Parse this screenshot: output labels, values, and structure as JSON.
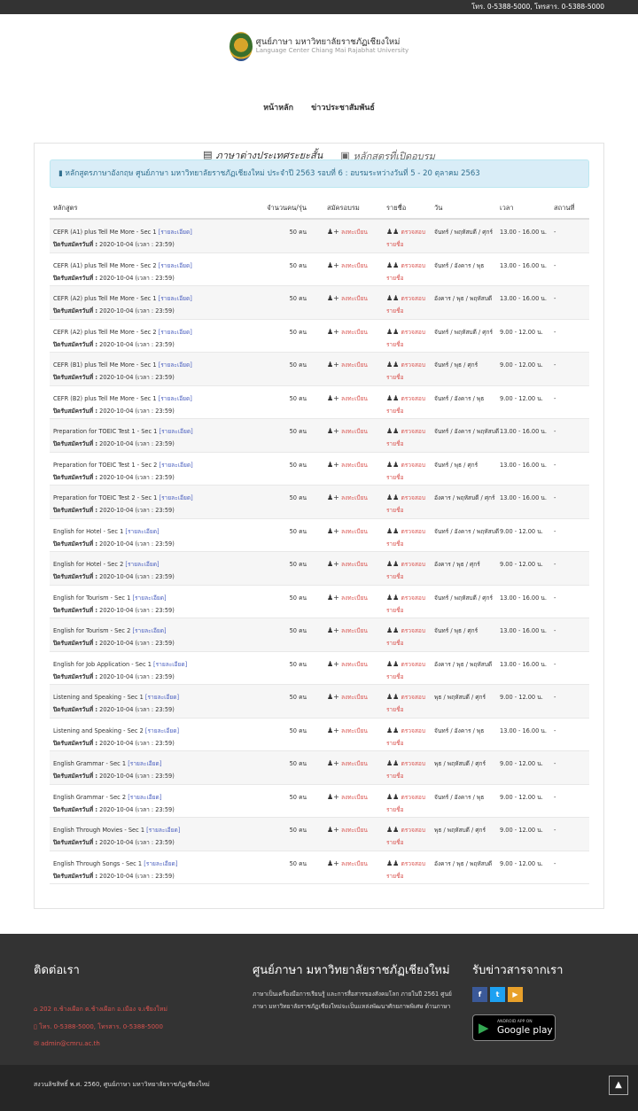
{
  "topbar": {
    "contact": "โทร. 0-5388-5000, โทรสาร. 0-5388-5000"
  },
  "brand": {
    "name_th": "ศูนย์ภาษา มหาวิทยาลัยราชภัฏเชียงใหม่",
    "name_en": "Language Center Chiang Mai Rajabhat University"
  },
  "nav": {
    "home": "หน้าหลัก",
    "news": "ข่าวประชาสัมพันธ์"
  },
  "tabs": {
    "active": "ภาษาต่างประเทศระยะสั้น",
    "inactive": "หลักสูตรที่เปิดอบรม"
  },
  "alert": {
    "text": "หลักสูตรภาษาอังกฤษ ศูนย์ภาษา มหาวิทยาลัยราชภัฏเชียงใหม่ ประจำปี 2563 รอบที่ 6 : อบรมระหว่างวันที่ 5 - 20 ตุลาคม 2563"
  },
  "table": {
    "headers": [
      "หลักสูตร",
      "จำนวนคน/รุ่น",
      "สมัครอบรม",
      "รายชื่อ",
      "วัน",
      "เวลา",
      "สถานที่"
    ],
    "detail_label": "[รายละเอียด]",
    "close_label": "ปิดรับสมัครวันที่ :",
    "register_label": "ลงทะเบียน",
    "check_label": "ตรวจสอบ",
    "check_label2": "รายชื่อ",
    "rows": [
      {
        "course": "CEFR (A1) plus Tell Me More - Sec 1",
        "close": "2020-10-04 (เวลา : 23:59)",
        "count": "50 คน",
        "days": "จันทร์ / พฤหัสบดี / ศุกร์",
        "time": "13.00 - 16.00 น.",
        "place": "-"
      },
      {
        "course": "CEFR (A1) plus Tell Me More - Sec 2",
        "close": "2020-10-04 (เวลา : 23:59)",
        "count": "50 คน",
        "days": "จันทร์ / อังคาร / พุธ",
        "time": "13.00 - 16.00 น.",
        "place": "-"
      },
      {
        "course": "CEFR (A2) plus Tell Me More - Sec 1",
        "close": "2020-10-04 (เวลา : 23:59)",
        "count": "50 คน",
        "days": "อังคาร / พุธ / พฤหัสบดี",
        "time": "13.00 - 16.00 น.",
        "place": "-"
      },
      {
        "course": "CEFR (A2) plus Tell Me More - Sec 2",
        "close": "2020-10-04 (เวลา : 23:59)",
        "count": "50 คน",
        "days": "จันทร์ / พฤหัสบดี / ศุกร์",
        "time": "9.00 - 12.00 น.",
        "place": "-"
      },
      {
        "course": "CEFR (B1) plus Tell Me More - Sec 1",
        "close": "2020-10-04 (เวลา : 23:59)",
        "count": "50 คน",
        "days": "จันทร์ / พุธ / ศุกร์",
        "time": "9.00 - 12.00 น.",
        "place": "-"
      },
      {
        "course": "CEFR (B2) plus Tell Me More - Sec 1",
        "close": "2020-10-04 (เวลา : 23:59)",
        "count": "50 คน",
        "days": "จันทร์ / อังคาร / พุธ",
        "time": "9.00 - 12.00 น.",
        "place": "-"
      },
      {
        "course": "Preparation for TOEIC Test 1 - Sec 1",
        "close": "2020-10-04 (เวลา : 23:59)",
        "count": "50 คน",
        "days": "จันทร์ / อังคาร / พฤหัสบดี",
        "time": "13.00 - 16.00 น.",
        "place": "-"
      },
      {
        "course": "Preparation for TOEIC Test 1 - Sec 2",
        "close": "2020-10-04 (เวลา : 23:59)",
        "count": "50 คน",
        "days": "จันทร์ / พุธ / ศุกร์",
        "time": "13.00 - 16.00 น.",
        "place": "-"
      },
      {
        "course": "Preparation for TOEIC Test 2 - Sec 1",
        "close": "2020-10-04 (เวลา : 23:59)",
        "count": "50 คน",
        "days": "อังคาร / พฤหัสบดี / ศุกร์",
        "time": "13.00 - 16.00 น.",
        "place": "-"
      },
      {
        "course": "English for Hotel - Sec 1",
        "close": "2020-10-04 (เวลา : 23:59)",
        "count": "50 คน",
        "days": "จันทร์ / อังคาร / พฤหัสบดี",
        "time": "9.00 - 12.00 น.",
        "place": "-"
      },
      {
        "course": "English for Hotel - Sec 2",
        "close": "2020-10-04 (เวลา : 23:59)",
        "count": "50 คน",
        "days": "อังคาร / พุธ / ศุกร์",
        "time": "9.00 - 12.00 น.",
        "place": "-"
      },
      {
        "course": "English for Tourism - Sec 1",
        "close": "2020-10-04 (เวลา : 23:59)",
        "count": "50 คน",
        "days": "จันทร์ / พฤหัสบดี / ศุกร์",
        "time": "13.00 - 16.00 น.",
        "place": "-"
      },
      {
        "course": "English for Tourism - Sec 2",
        "close": "2020-10-04 (เวลา : 23:59)",
        "count": "50 คน",
        "days": "จันทร์ / พุธ / ศุกร์",
        "time": "13.00 - 16.00 น.",
        "place": "-"
      },
      {
        "course": "English for Job Application - Sec 1",
        "close": "2020-10-04 (เวลา : 23:59)",
        "count": "50 คน",
        "days": "อังคาร / พุธ / พฤหัสบดี",
        "time": "13.00 - 16.00 น.",
        "place": "-"
      },
      {
        "course": "Listening and Speaking - Sec 1",
        "close": "2020-10-04 (เวลา : 23:59)",
        "count": "50 คน",
        "days": "พุธ / พฤหัสบดี / ศุกร์",
        "time": "9.00 - 12.00 น.",
        "place": "-"
      },
      {
        "course": "Listening and Speaking - Sec 2",
        "close": "2020-10-04 (เวลา : 23:59)",
        "count": "50 คน",
        "days": "จันทร์ / อังคาร / พุธ",
        "time": "13.00 - 16.00 น.",
        "place": "-"
      },
      {
        "course": "English Grammar - Sec 1",
        "close": "2020-10-04 (เวลา : 23:59)",
        "count": "50 คน",
        "days": "พุธ / พฤหัสบดี / ศุกร์",
        "time": "9.00 - 12.00 น.",
        "place": "-"
      },
      {
        "course": "English Grammar - Sec 2",
        "close": "2020-10-04 (เวลา : 23:59)",
        "count": "50 คน",
        "days": "จันทร์ / อังคาร / พุธ",
        "time": "9.00 - 12.00 น.",
        "place": "-"
      },
      {
        "course": "English Through Movies - Sec 1",
        "close": "2020-10-04 (เวลา : 23:59)",
        "count": "50 คน",
        "days": "พุธ / พฤหัสบดี / ศุกร์",
        "time": "9.00 - 12.00 น.",
        "place": "-"
      },
      {
        "course": "English Through Songs - Sec 1",
        "close": "2020-10-04 (เวลา : 23:59)",
        "count": "50 คน",
        "days": "อังคาร / พุธ / พฤหัสบดี",
        "time": "9.00 - 12.00 น.",
        "place": "-"
      }
    ]
  },
  "footer": {
    "contact_title": "ติดต่อเรา",
    "address": "202 ถ.ช้างเผือก ต.ช้างเผือก อ.เมือง จ.เชียงใหม่",
    "phone": "โทร. 0-5388-5000, โทรสาร. 0-5388-5000",
    "email": "admin@cmru.ac.th",
    "center_title": "ศูนย์ภาษา มหาวิทยาลัยราชภัฏเชียงใหม่",
    "center_desc": "ภาษาเป็นเครื่องมือการเรียนรู้ และการสื่อสารของสังคมโลก ภายในปี 2561 ศูนย์ภาษา มหาวิทยาลัยราชภัฏเชียงใหม่จะเป็นแหล่งพัฒนาศักยภาพพิเศษ ด้านภาษา",
    "news_title": "รับข่าวสารจากเรา",
    "social": [
      "f",
      "t",
      "▶"
    ],
    "gplay_top": "ANDROID APP ON",
    "gplay_main": "Google play"
  },
  "bottom": {
    "copyright": "สงวนลิขสิทธิ์ พ.ศ. 2560, ศูนย์ภาษา มหาวิทยาลัยราชภัฏเชียงใหม่",
    "totop": "▲"
  }
}
